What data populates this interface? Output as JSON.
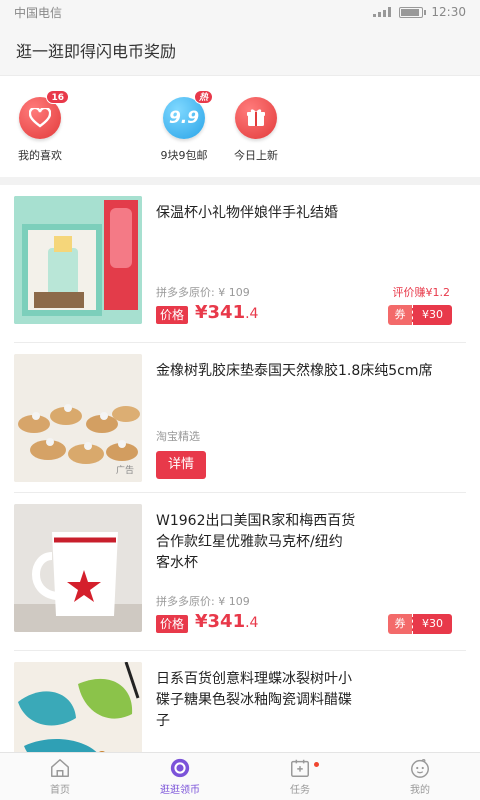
{
  "status_bar": {
    "carrier": "中国电信",
    "time": "12:30"
  },
  "header": {
    "title": "逛一逛即得闪电币奖励"
  },
  "quick_entries": [
    {
      "label": "我的喜欢",
      "badge": "16",
      "icon": "heart-icon"
    },
    {
      "label": "9块9包邮",
      "badge": "热",
      "icon_text": "9.9",
      "icon": "nine-nine-icon"
    },
    {
      "label": "今日上新",
      "icon": "gift-icon"
    }
  ],
  "products": [
    {
      "title": "保温杯小礼物伴娘伴手礼结婚",
      "original_price": "拼多多原价: ¥ 109",
      "price_tag": "价格",
      "price_main": "¥341",
      "price_decimal": ".4",
      "reward": "评价赚¥1.2",
      "coupon_label": "券",
      "coupon_value": "¥30"
    },
    {
      "title": "金橡树乳胶床垫泰国天然橡胶1.8床纯5cm席",
      "source": "淘宝精选",
      "button": "详情",
      "ad_label": "广告"
    },
    {
      "title": "W1962出口美国R家和梅西百货合作款红星优雅款马克杯/纽约客水杯",
      "original_price": "拼多多原价: ¥ 109",
      "price_tag": "价格",
      "price_main": "¥341",
      "price_decimal": ".4",
      "coupon_label": "券",
      "coupon_value": "¥30"
    },
    {
      "title": "日系百货创意料理蝶冰裂树叶小碟子糖果色裂冰釉陶瓷调料醋碟子"
    }
  ],
  "bottom_nav": [
    {
      "label": "首页",
      "icon": "home-icon"
    },
    {
      "label": "逛逛领币",
      "icon": "coin-icon",
      "active": true
    },
    {
      "label": "任务",
      "icon": "calendar-icon",
      "dot": true
    },
    {
      "label": "我的",
      "icon": "face-icon"
    }
  ],
  "colors": {
    "accent_red": "#e8394a",
    "nav_active": "#7b53d9",
    "hot_blue": "#2aa4e8"
  }
}
